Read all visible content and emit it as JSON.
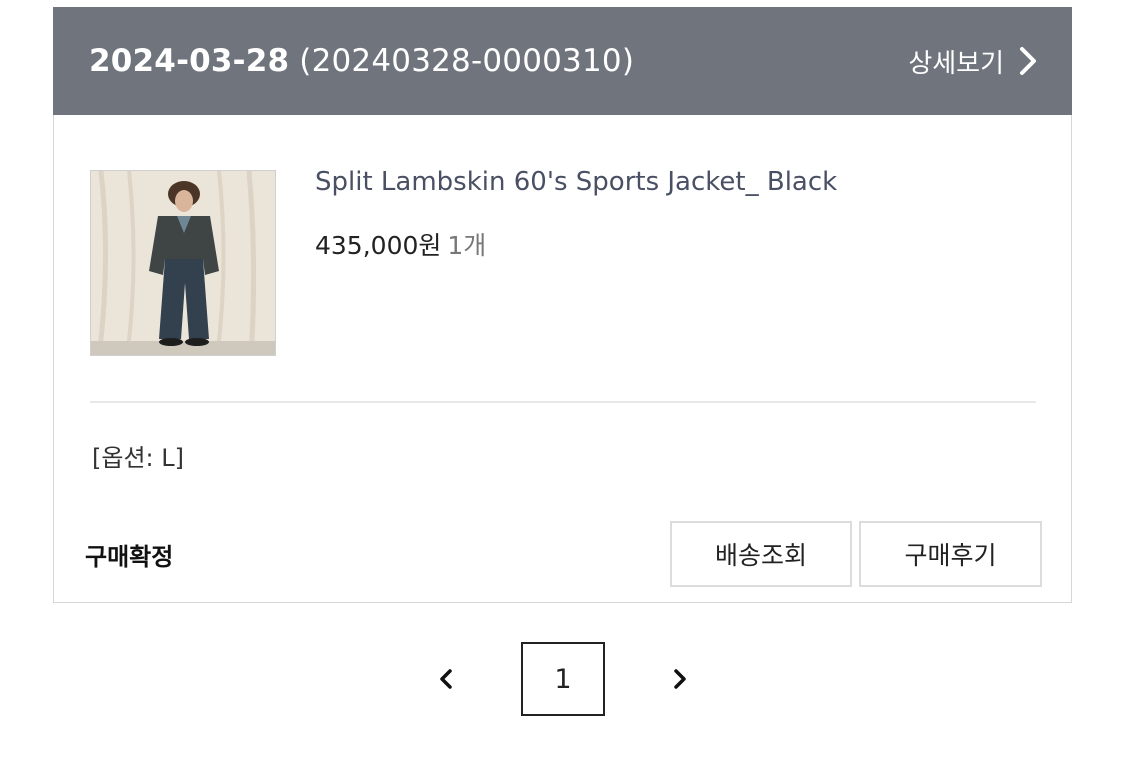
{
  "order": {
    "date": "2024-03-28",
    "number": "(20240328-0000310)",
    "detail_label": "상세보기",
    "status": "구매확정"
  },
  "product": {
    "name": "Split Lambskin 60's Sports Jacket_ Black",
    "price": "435,000원",
    "quantity": "1개",
    "option": "[옵션: L]"
  },
  "actions": {
    "tracking_label": "배송조회",
    "review_label": "구매후기"
  },
  "pagination": {
    "current_page": "1"
  },
  "colors": {
    "header_bg": "#6f747d",
    "product_name": "#4a5064"
  },
  "icons": {
    "detail": "chevron-right-icon",
    "prev": "chevron-left-icon",
    "next": "chevron-right-icon"
  }
}
